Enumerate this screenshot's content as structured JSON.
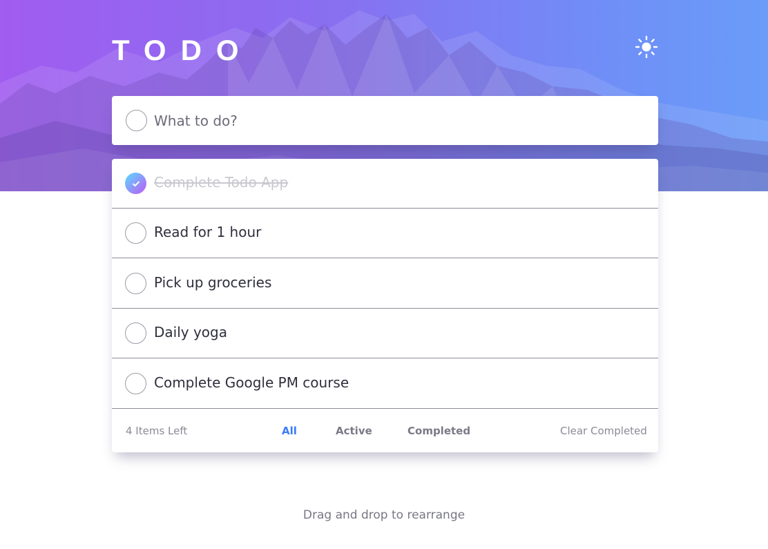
{
  "header": {
    "title": "TODO",
    "theme_icon": "sun-icon"
  },
  "new_todo": {
    "placeholder": "What to do?",
    "value": ""
  },
  "todos": [
    {
      "text": "Complete Todo App",
      "completed": true
    },
    {
      "text": "Read for 1 hour",
      "completed": false
    },
    {
      "text": "Pick up groceries",
      "completed": false
    },
    {
      "text": "Daily yoga",
      "completed": false
    },
    {
      "text": "Complete Google PM course",
      "completed": false
    }
  ],
  "footer": {
    "items_left": "4 Items Left",
    "filters": [
      "All",
      "Active",
      "Completed"
    ],
    "active_filter": "All",
    "clear_label": "Clear Completed"
  },
  "hint": "Drag and drop to rearrange",
  "colors": {
    "accent": "#3a7bfd",
    "check_gradient_start": "#57ddff",
    "check_gradient_end": "#c058f3",
    "hero_gradient_start": "#a15cf0",
    "hero_gradient_end": "#6a9cf8"
  }
}
